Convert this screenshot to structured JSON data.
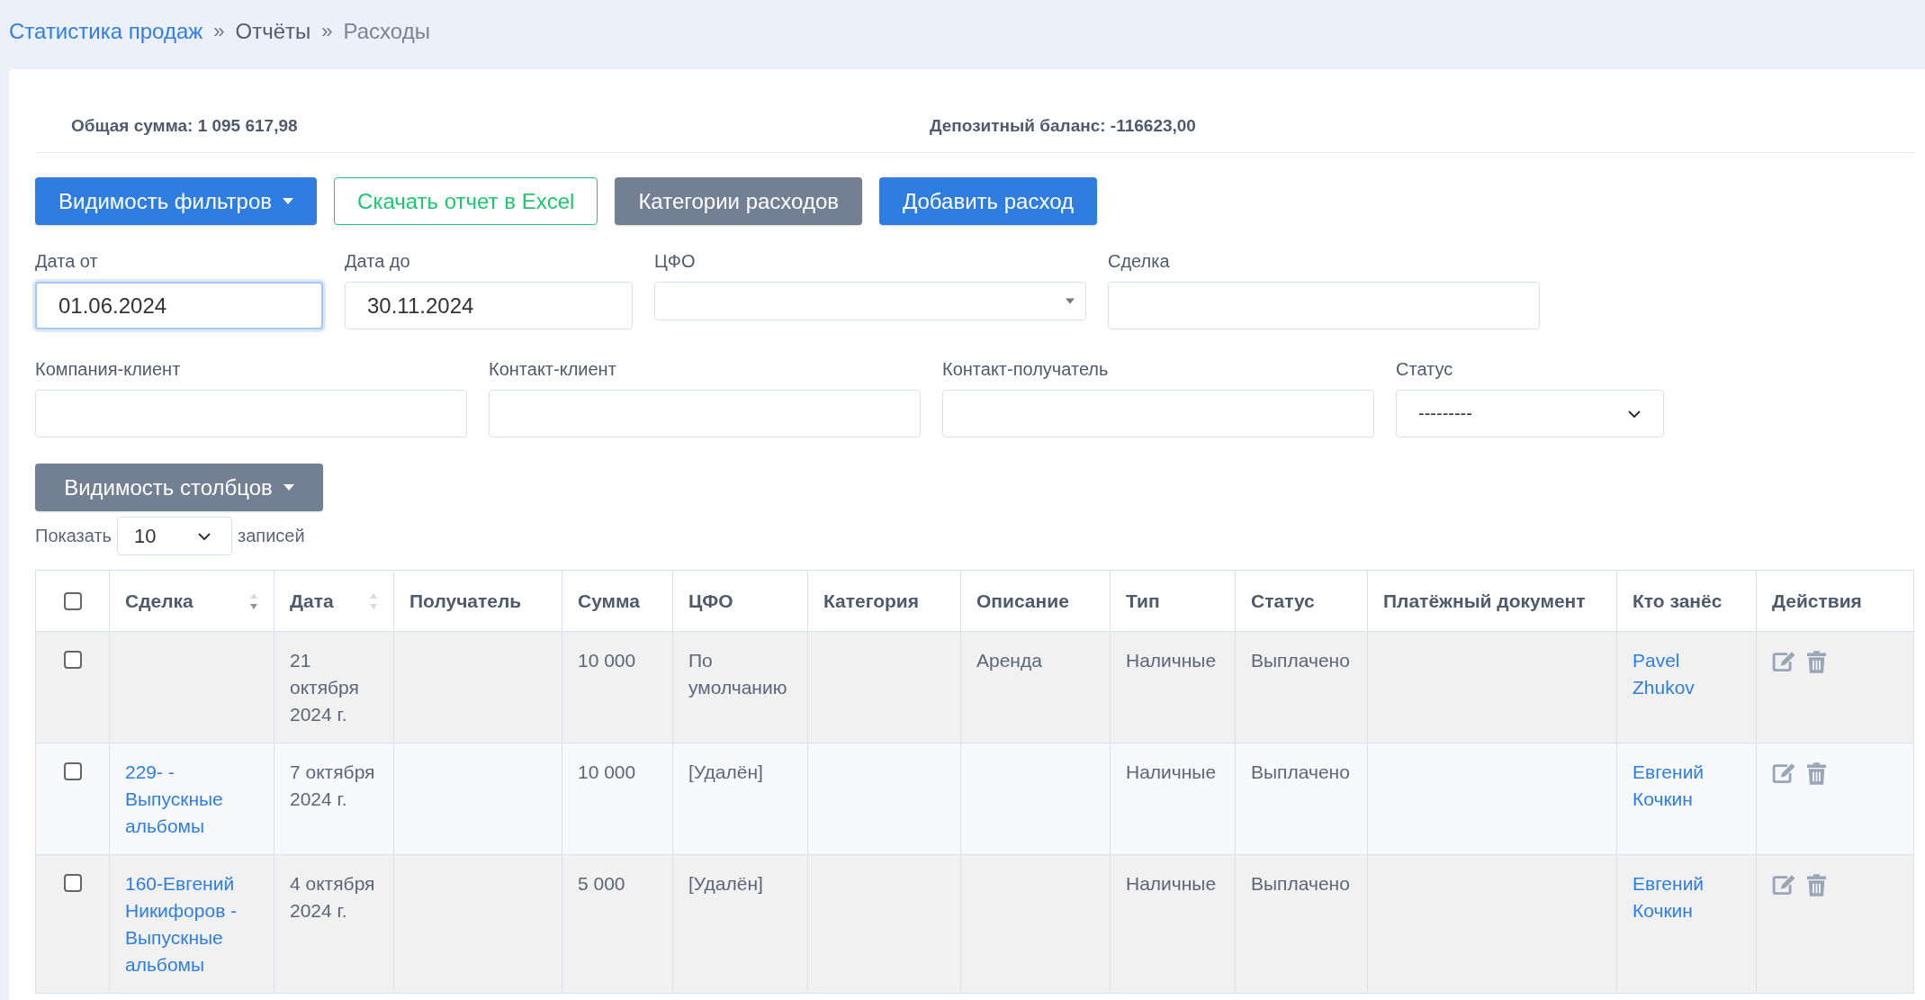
{
  "breadcrumb": [
    {
      "label": "Статистика продаж",
      "kind": "link"
    },
    {
      "label": "Отчёты",
      "kind": "text"
    },
    {
      "label": "Расходы",
      "kind": "current"
    }
  ],
  "breadcrumb_separator": "»",
  "totals": [
    "Общая сумма: 1 095 617,98",
    "Депозитный баланс: -116623,00"
  ],
  "buttons": [
    {
      "label": "Видимость фильтров",
      "kind": "primary",
      "dropdown": true
    },
    {
      "label": "Скачать отчет в Excel",
      "kind": "outline-success",
      "dropdown": false
    },
    {
      "label": "Категории расходов",
      "kind": "secondary",
      "dropdown": false
    },
    {
      "label": "Добавить расход",
      "kind": "primary",
      "dropdown": false
    }
  ],
  "filters": [
    [
      {
        "label": "Дата от",
        "kind": "date",
        "value": "01.06.2024",
        "focused": true
      },
      {
        "label": "Дата до",
        "kind": "date",
        "value": "30.11.2024",
        "focused": false
      },
      {
        "label": "ЦФО",
        "kind": "select",
        "focused": false
      },
      {
        "label": "Сделка",
        "kind": "text",
        "focused": false
      }
    ],
    [
      {
        "label": "Компания-клиент",
        "kind": "text",
        "focused": false
      },
      {
        "label": "Контакт-клиент",
        "kind": "text",
        "focused": false
      },
      {
        "label": "Контакт-получатель",
        "kind": "text",
        "focused": false
      },
      {
        "label": "Статус",
        "kind": "dropdown",
        "value": "---------",
        "focused": false
      }
    ]
  ],
  "columns_button": {
    "label": "Видимость столбцов",
    "dropdown": true
  },
  "page_length": {
    "before": "Показать",
    "value": "10",
    "after": "записей"
  },
  "table": {
    "select_all_checked": false,
    "columns": [
      {
        "label": "Сделка",
        "sorted_descending": true
      },
      {
        "label": "Дата",
        "sorted_descending": false
      },
      {
        "label": "Получатель"
      },
      {
        "label": "Сумма"
      },
      {
        "label": "ЦФО"
      },
      {
        "label": "Категория"
      },
      {
        "label": "Описание"
      },
      {
        "label": "Тип"
      },
      {
        "label": "Статус"
      },
      {
        "label": "Платёжный документ"
      },
      {
        "label": "Кто занёс"
      },
      {
        "label": "Действия"
      }
    ],
    "rows": [
      {
        "selected": false,
        "date": "21 октября 2024 г.",
        "amount": "10 000",
        "cfo": "По умолчанию",
        "description": "Аренда",
        "type": "Наличные",
        "status": "Выплачено",
        "author": "Pavel Zhukov"
      },
      {
        "selected": false,
        "deal": "229- - Выпускные альбомы",
        "date": "7 октября 2024 г.",
        "amount": "10 000",
        "cfo": "[Удалён]",
        "type": "Наличные",
        "status": "Выплачено",
        "author": "Евгений Кочкин"
      },
      {
        "selected": false,
        "deal": "160-Евгений Никифоров - Выпускные альбомы",
        "date": "4 октября 2024 г.",
        "amount": "5 000",
        "cfo": "[Удалён]",
        "type": "Наличные",
        "status": "Выплачено",
        "author": "Евгений Кочкин"
      }
    ]
  }
}
